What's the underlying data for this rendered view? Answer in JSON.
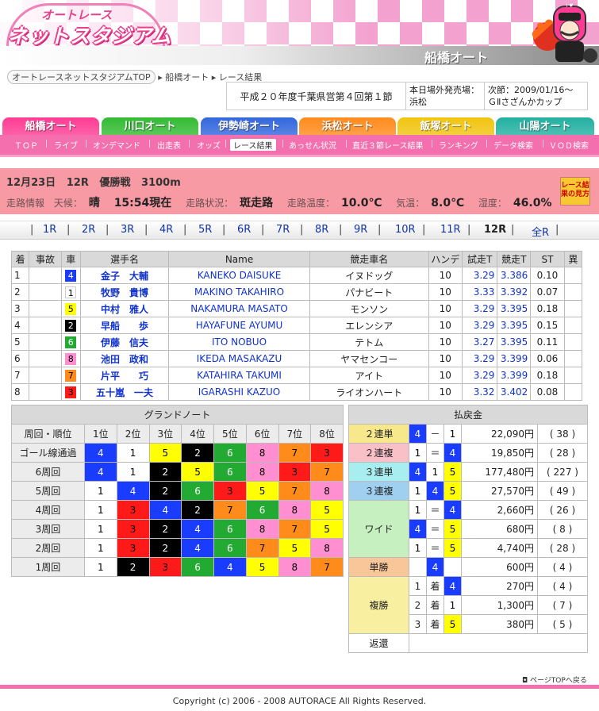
{
  "header": {
    "logo_top": "オートレース",
    "logo_main": "ネットスタジアム",
    "site_name": "船橋オート"
  },
  "breadcrumb": {
    "home": "オートレースネットスタジアムTOP",
    "items": [
      "船橋オート",
      "レース結果"
    ]
  },
  "meet": {
    "title": "平成２０年度千葉県営第４回第１節",
    "today_label": "本日場外発売場：",
    "today_value": "浜松",
    "next_line1": "次節：2009/01/16～",
    "next_line2": "ＧⅡさざんかカップ"
  },
  "track_tabs": [
    {
      "label": "船橋オート",
      "color": "#ff3b93"
    },
    {
      "label": "川口オート",
      "color": "#33bb33"
    },
    {
      "label": "伊勢崎オート",
      "color": "#3366dd"
    },
    {
      "label": "浜松オート",
      "color": "#ff8a1c"
    },
    {
      "label": "飯塚オート",
      "color": "#f1c40f"
    },
    {
      "label": "山陽オート",
      "color": "#22b0a0"
    }
  ],
  "sub_nav": [
    "ＴＯＰ",
    "ライブ",
    "オンデマンド",
    "出走表",
    "オッズ",
    "レース結果",
    "あっせん状況",
    "直近３節レース結果",
    "ランキング",
    "データ検索",
    "ＶＯＤ検索"
  ],
  "race_info": {
    "date": "12月23日",
    "race": "12R",
    "grade": "優勝戦",
    "distance": "3100m",
    "label_track": "走路情報",
    "label_weather": "天候：",
    "weather": "晴",
    "time": "15:54現在",
    "label_condition": "走路状況：",
    "condition": "斑走路",
    "label_track_temp": "走路温度：",
    "track_temp": "10.0℃",
    "label_air_temp": "気温：",
    "air_temp": "8.0℃",
    "label_humidity": "湿度：",
    "humidity": "46.0%",
    "guide": "レース結果の見方"
  },
  "race_nav": [
    "1R",
    "2R",
    "3R",
    "4R",
    "5R",
    "6R",
    "7R",
    "8R",
    "9R",
    "10R",
    "11R",
    "12R",
    "全R"
  ],
  "car_colors": {
    "1": {
      "bg": "#ffffff",
      "fg": "#000000"
    },
    "2": {
      "bg": "#000000",
      "fg": "#ffffff"
    },
    "3": {
      "bg": "#ff1a1a",
      "fg": "#000000"
    },
    "4": {
      "bg": "#1a3cff",
      "fg": "#ffffff"
    },
    "5": {
      "bg": "#ffff00",
      "fg": "#000000"
    },
    "6": {
      "bg": "#22aa33",
      "fg": "#ffffff"
    },
    "7": {
      "bg": "#ff8c1a",
      "fg": "#000000"
    },
    "8": {
      "bg": "#ff8fd0",
      "fg": "#000000"
    }
  },
  "results": {
    "headers": [
      "着",
      "事故",
      "車",
      "選手名",
      "Name",
      "競走車名",
      "ハンデ",
      "試走T",
      "競走T",
      "ST",
      "異"
    ],
    "rows": [
      {
        "rank": "1",
        "accident": "",
        "car": "4",
        "name": "金子　大輔",
        "name_en": "KANEKO DAISUKE",
        "bike": "イヌドッグ",
        "handicap": "10",
        "trial": "3.29",
        "race_time": "3.386",
        "st": "0.10",
        "ab": ""
      },
      {
        "rank": "2",
        "accident": "",
        "car": "1",
        "name": "牧野　貴博",
        "name_en": "MAKINO TAKAHIRO",
        "bike": "パナビート",
        "handicap": "10",
        "trial": "3.33",
        "race_time": "3.392",
        "st": "0.07",
        "ab": ""
      },
      {
        "rank": "3",
        "accident": "",
        "car": "5",
        "name": "中村　雅人",
        "name_en": "NAKAMURA MASATO",
        "bike": "モンソン",
        "handicap": "10",
        "trial": "3.29",
        "race_time": "3.395",
        "st": "0.18",
        "ab": ""
      },
      {
        "rank": "4",
        "accident": "",
        "car": "2",
        "name": "早船　　歩",
        "name_en": "HAYAFUNE AYUMU",
        "bike": "エレンシア",
        "handicap": "10",
        "trial": "3.29",
        "race_time": "3.395",
        "st": "0.15",
        "ab": ""
      },
      {
        "rank": "5",
        "accident": "",
        "car": "6",
        "name": "伊藤　信夫",
        "name_en": "ITO NOBUO",
        "bike": "テトム",
        "handicap": "10",
        "trial": "3.27",
        "race_time": "3.395",
        "st": "0.11",
        "ab": ""
      },
      {
        "rank": "6",
        "accident": "",
        "car": "8",
        "name": "池田　政和",
        "name_en": "IKEDA MASAKAZU",
        "bike": "ヤマセンコー",
        "handicap": "10",
        "trial": "3.29",
        "race_time": "3.399",
        "st": "0.06",
        "ab": ""
      },
      {
        "rank": "7",
        "accident": "",
        "car": "7",
        "name": "片平　　巧",
        "name_en": "KATAHIRA TAKUMI",
        "bike": "アイト",
        "handicap": "10",
        "trial": "3.29",
        "race_time": "3.399",
        "st": "0.18",
        "ab": ""
      },
      {
        "rank": "8",
        "accident": "",
        "car": "3",
        "name": "五十嵐　一夫",
        "name_en": "IGARASHI KAZUO",
        "bike": "ライオンハート",
        "handicap": "10",
        "trial": "3.32",
        "race_time": "3.402",
        "st": "0.08",
        "ab": ""
      }
    ]
  },
  "grand_note": {
    "title": "グランドノート",
    "headers": [
      "周回・順位",
      "1位",
      "2位",
      "3位",
      "4位",
      "5位",
      "6位",
      "7位",
      "8位"
    ],
    "rows": [
      {
        "label": "ゴール線通過",
        "cars": [
          "4",
          "1",
          "5",
          "2",
          "6",
          "8",
          "7",
          "3"
        ]
      },
      {
        "label": "6周回",
        "cars": [
          "4",
          "1",
          "2",
          "5",
          "6",
          "8",
          "3",
          "7"
        ]
      },
      {
        "label": "5周回",
        "cars": [
          "1",
          "4",
          "2",
          "6",
          "3",
          "5",
          "7",
          "8"
        ]
      },
      {
        "label": "4周回",
        "cars": [
          "1",
          "3",
          "4",
          "2",
          "7",
          "6",
          "8",
          "5"
        ]
      },
      {
        "label": "3周回",
        "cars": [
          "1",
          "3",
          "2",
          "4",
          "6",
          "8",
          "7",
          "5"
        ]
      },
      {
        "label": "2周回",
        "cars": [
          "1",
          "3",
          "2",
          "4",
          "6",
          "7",
          "5",
          "8"
        ]
      },
      {
        "label": "1周回",
        "cars": [
          "1",
          "2",
          "3",
          "6",
          "4",
          "5",
          "8",
          "7"
        ]
      }
    ]
  },
  "payout": {
    "title": "払戻金",
    "exacta": {
      "label": "２連単",
      "color": "#f7e98b",
      "combo": [
        "4",
        "－",
        "1"
      ],
      "amount": "22,090円",
      "pop": "( 38 )"
    },
    "quinella": {
      "label": "２連複",
      "color": "#f9c0c8",
      "combo": [
        "1",
        "＝",
        "4"
      ],
      "amount": "19,850円",
      "pop": "( 28 )"
    },
    "trifecta": {
      "label": "３連単",
      "color": "#a8eef0",
      "combo": [
        "4",
        "1",
        "5"
      ],
      "amount": "177,480円",
      "pop": "( 227 )"
    },
    "trio": {
      "label": "３連複",
      "color": "#9fd0f0",
      "combo": [
        "1",
        "4",
        "5"
      ],
      "amount": "27,570円",
      "pop": "( 49 )"
    },
    "wide": {
      "label": "ワイド",
      "color": "#c7f0c0",
      "rows": [
        {
          "combo": [
            "1",
            "＝",
            "4"
          ],
          "amount": "2,660円",
          "pop": "( 26 )"
        },
        {
          "combo": [
            "4",
            "＝",
            "5"
          ],
          "amount": "680円",
          "pop": "( 8 )"
        },
        {
          "combo": [
            "1",
            "＝",
            "5"
          ],
          "amount": "4,740円",
          "pop": "( 28 )"
        }
      ]
    },
    "win": {
      "label": "単勝",
      "color": "#f9c69a",
      "car": "4",
      "amount": "600円",
      "pop": "( 4 )"
    },
    "place": {
      "label": "複勝",
      "color": "#f8f0a0",
      "rows": [
        {
          "pos": "1",
          "chaku": "着",
          "car": "4",
          "amount": "270円",
          "pop": "( 4 )"
        },
        {
          "pos": "2",
          "chaku": "着",
          "car": "1",
          "amount": "1,300円",
          "pop": "( 7 )"
        },
        {
          "pos": "3",
          "chaku": "着",
          "car": "5",
          "amount": "380円",
          "pop": "( 5 )"
        }
      ]
    },
    "refund": {
      "label": "返還"
    }
  },
  "footer": {
    "page_top": "ページTOPへ戻る",
    "copyright": "Copyright (c) 2006 - 2008 AUTORACE All Rights Reserved."
  }
}
